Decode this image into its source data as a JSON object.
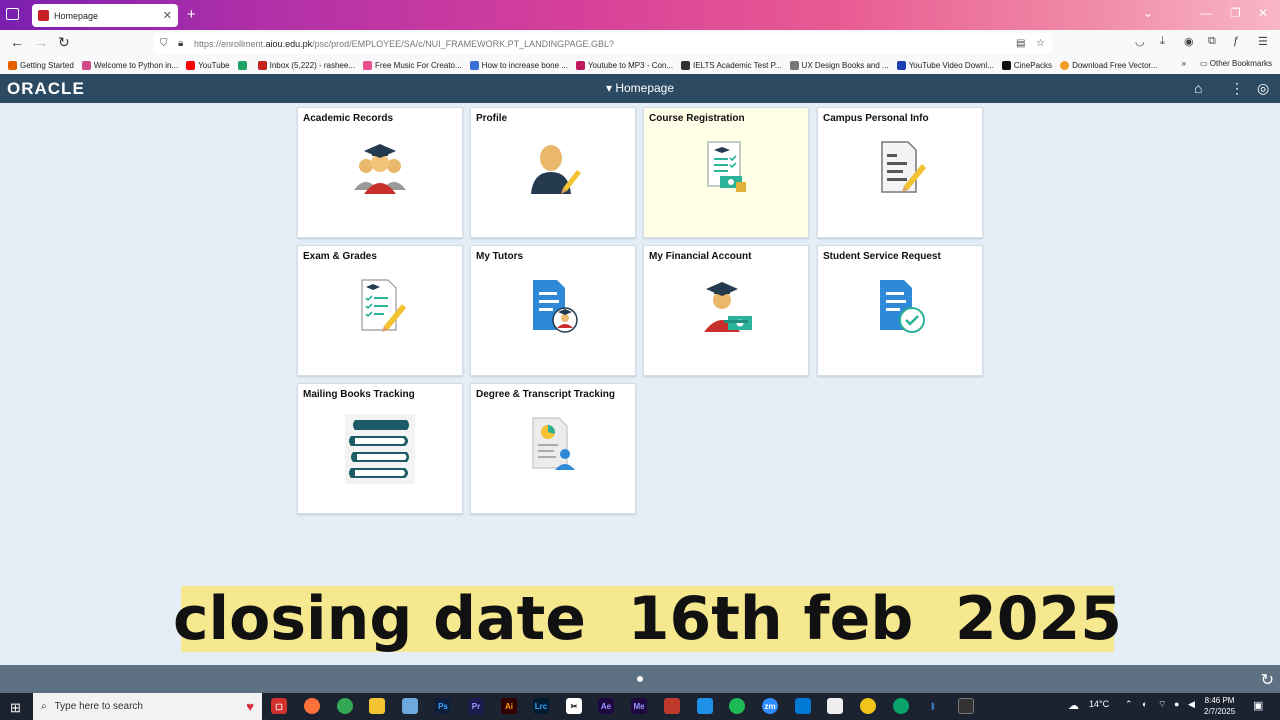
{
  "browser": {
    "tab_title": "Homepage",
    "url_prefix": "https://enrollment.",
    "url_domain": "aiou.edu.pk",
    "url_path": "/psc/prod/EMPLOYEE/SA/c/NUI_FRAMEWORK.PT_LANDINGPAGE.GBL?",
    "new_tab": "+",
    "tab_close": "✕",
    "bookmarks": [
      {
        "label": "Getting Started",
        "color": "#e66000"
      },
      {
        "label": "Welcome to Python in...",
        "color": "#d24a8a"
      },
      {
        "label": "YouTube",
        "color": "#ff0000"
      },
      {
        "label": "",
        "color": "#1fa463"
      },
      {
        "label": "Inbox (5,222) - rashee...",
        "color": "#c5221f"
      },
      {
        "label": "Free Music For Creato...",
        "color": "#e94f8f"
      },
      {
        "label": "How to increase bone ...",
        "color": "#3a6fd8"
      },
      {
        "label": "Youtube to MP3 - Con...",
        "color": "#c2185b"
      },
      {
        "label": "IELTS Academic Test P...",
        "color": "#333333"
      },
      {
        "label": "UX Design Books and ...",
        "color": "#777777"
      },
      {
        "label": "YouTube Video Downl...",
        "color": "#1a3fb0"
      },
      {
        "label": "CinePacks",
        "color": "#111111"
      },
      {
        "label": "Download Free Vector...",
        "color": "#f29c1f"
      }
    ],
    "other_bookmarks": "Other Bookmarks"
  },
  "header": {
    "logo": "ORACLE",
    "title": "▾ Homepage"
  },
  "tiles": [
    {
      "title": "Academic Records",
      "icon": "graduate-group-icon"
    },
    {
      "title": "Profile",
      "icon": "user-edit-icon"
    },
    {
      "title": "Course Registration",
      "icon": "registration-form-icon"
    },
    {
      "title": "Campus Personal Info",
      "icon": "document-edit-icon"
    },
    {
      "title": "Exam & Grades",
      "icon": "exam-sheet-icon"
    },
    {
      "title": "My Tutors",
      "icon": "tutor-document-icon"
    },
    {
      "title": "My Financial Account",
      "icon": "graduate-money-icon"
    },
    {
      "title": "Student Service Request",
      "icon": "request-approved-icon"
    },
    {
      "title": "Mailing Books Tracking",
      "icon": "books-stack-icon"
    },
    {
      "title": "Degree & Transcript Tracking",
      "icon": "transcript-user-icon"
    }
  ],
  "banner": "closing date  16th feb  2025",
  "taskbar": {
    "search_placeholder": "Type here to search",
    "weather": "14°C",
    "time": "8:46 PM",
    "date": "2/7/2025"
  }
}
